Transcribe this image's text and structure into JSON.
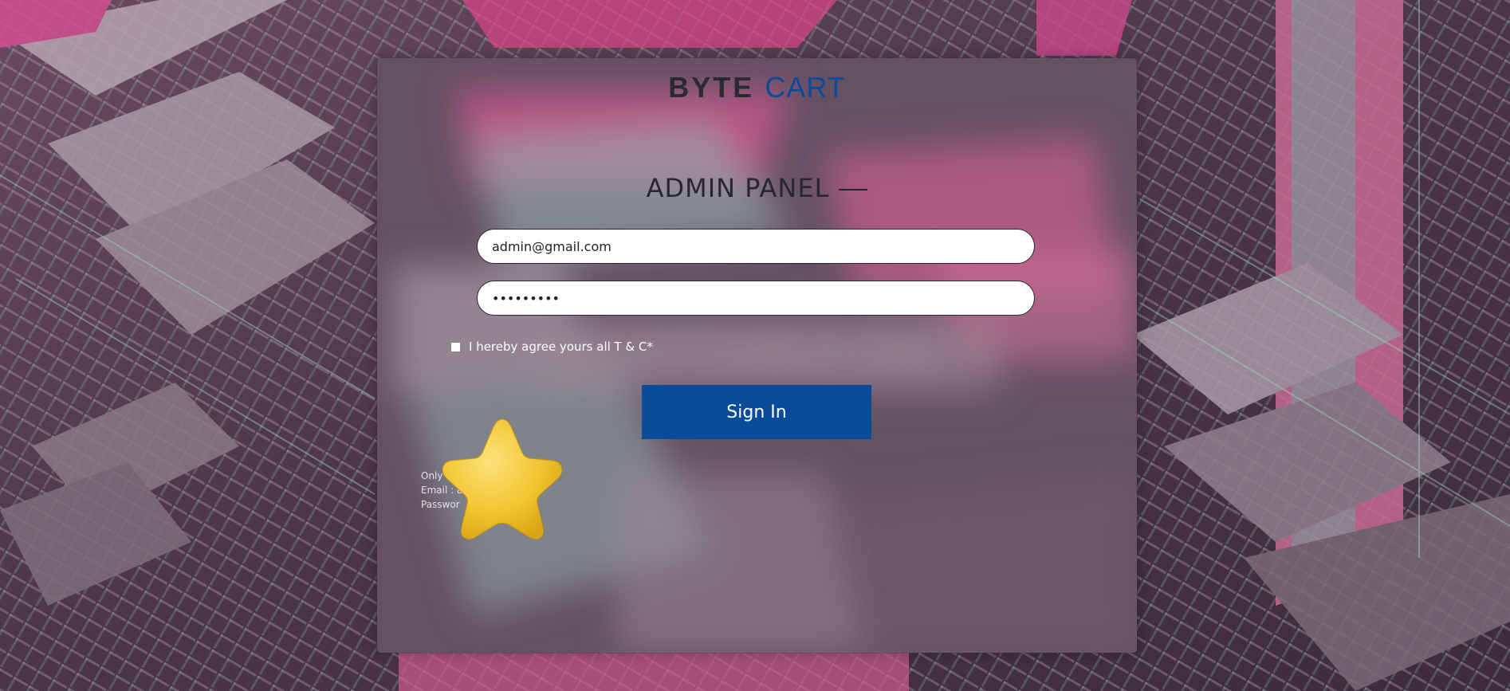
{
  "logo": {
    "part1": "BYTE",
    "part2": "CART"
  },
  "title": "ADMIN PANEL",
  "form": {
    "email_value": "admin@gmail.com",
    "password_value": "•••••••••",
    "agree_label": "I hereby agree yours all T & C*",
    "signin_label": "Sign In"
  },
  "note": {
    "line1": "Only T                         in Admin Panel",
    "line2": "Email : a",
    "line3": "Passwor"
  },
  "colors": {
    "brand_blue": "#0a4c9a",
    "text_dark": "#2a2630"
  },
  "icons": {
    "decoration": "star-icon"
  }
}
